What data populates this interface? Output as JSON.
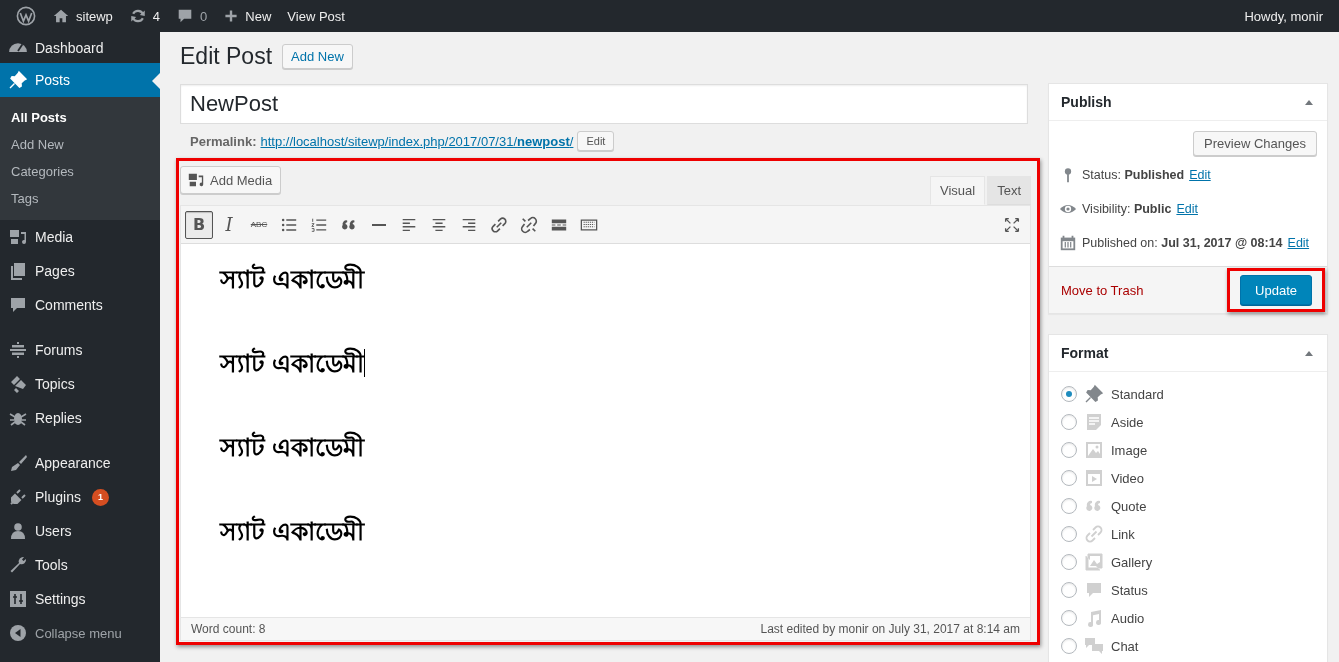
{
  "admin_bar": {
    "site_name": "sitewp",
    "updates_count": "4",
    "comments_count": "0",
    "new_label": "New",
    "view_post_label": "View Post",
    "greeting": "Howdy, monir"
  },
  "sidebar": {
    "groups": [
      [
        {
          "label": "Dashboard",
          "selected": false
        },
        {
          "label": "Posts",
          "selected": true,
          "children": [
            {
              "label": "All Posts",
              "selected": true
            },
            {
              "label": "Add New",
              "selected": false
            },
            {
              "label": "Categories",
              "selected": false
            },
            {
              "label": "Tags",
              "selected": false
            }
          ]
        },
        {
          "label": "Media",
          "selected": false
        },
        {
          "label": "Pages",
          "selected": false
        },
        {
          "label": "Comments",
          "selected": false
        }
      ],
      [
        {
          "label": "Forums",
          "selected": false
        },
        {
          "label": "Topics",
          "selected": false
        },
        {
          "label": "Replies",
          "selected": false
        }
      ],
      [
        {
          "label": "Appearance",
          "selected": false
        },
        {
          "label": "Plugins",
          "selected": false,
          "badge": "1"
        },
        {
          "label": "Users",
          "selected": false
        },
        {
          "label": "Tools",
          "selected": false
        },
        {
          "label": "Settings",
          "selected": false
        }
      ]
    ],
    "collapse_label": "Collapse menu"
  },
  "page": {
    "heading": "Edit Post",
    "add_new": "Add New"
  },
  "post": {
    "title": "NewPost",
    "permalink_label": "Permalink:",
    "permalink_url": "http://localhost/sitewp/index.php/2017/07/31/**newpost**/",
    "permalink_edit": "Edit"
  },
  "editor": {
    "highlighted": true,
    "add_media": "Add Media",
    "tabs": [
      {
        "label": "Visual",
        "selected": true
      },
      {
        "label": "Text",
        "selected": false
      }
    ],
    "toolbar": [
      {
        "kind": "text",
        "label": "B",
        "active": true
      },
      {
        "kind": "text",
        "label": "I",
        "active": false
      },
      {
        "kind": "text",
        "label": "ABC",
        "active": false
      },
      {
        "kind": "icon",
        "active": false
      },
      {
        "kind": "icon",
        "active": false
      },
      {
        "kind": "icon",
        "active": false
      },
      {
        "kind": "icon",
        "active": false
      },
      {
        "kind": "icon",
        "active": false
      },
      {
        "kind": "icon",
        "active": false
      },
      {
        "kind": "icon",
        "active": false
      },
      {
        "kind": "icon",
        "active": false
      },
      {
        "kind": "icon",
        "active": false
      },
      {
        "kind": "icon",
        "active": false
      },
      {
        "kind": "icon",
        "active": false
      }
    ],
    "paragraphs": [
      {
        "text": "স্যাট একাডেমী",
        "cursor": false
      },
      {
        "text": "স্যাট একাডেমী",
        "cursor": true
      },
      {
        "text": "স্যাট একাডেমী",
        "cursor": false
      },
      {
        "text": "স্যাট একাডেমী",
        "cursor": false
      }
    ],
    "word_count": "Word count: 8",
    "last_edited": "Last edited by monir on July 31, 2017 at 8:14 am"
  },
  "publish": {
    "title": "Publish",
    "expanded": true,
    "preview": "Preview Changes",
    "rows": [
      {
        "label": "Status:",
        "value": "Published",
        "link": "Edit"
      },
      {
        "label": "Visibility:",
        "value": "Public",
        "link": "Edit"
      },
      {
        "label": "Published on:",
        "value": "Jul 31, 2017 @ 08:14",
        "link": "Edit"
      }
    ],
    "trash": "Move to Trash",
    "update": "Update",
    "update_highlighted": true
  },
  "format": {
    "title": "Format",
    "expanded": true,
    "options": [
      {
        "label": "Standard",
        "selected": true
      },
      {
        "label": "Aside",
        "selected": false
      },
      {
        "label": "Image",
        "selected": false
      },
      {
        "label": "Video",
        "selected": false
      },
      {
        "label": "Quote",
        "selected": false
      },
      {
        "label": "Link",
        "selected": false
      },
      {
        "label": "Gallery",
        "selected": false
      },
      {
        "label": "Status",
        "selected": false
      },
      {
        "label": "Audio",
        "selected": false
      },
      {
        "label": "Chat",
        "selected": false
      }
    ]
  }
}
